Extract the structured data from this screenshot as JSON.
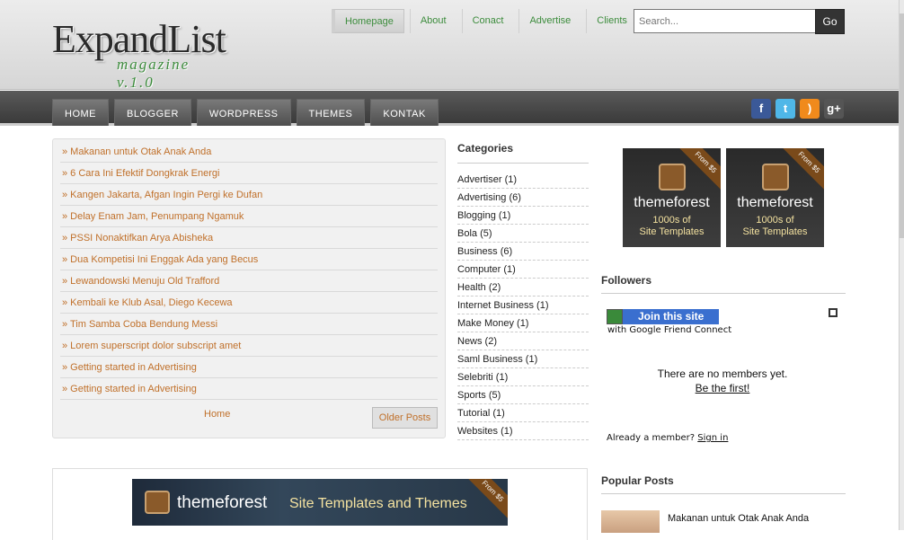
{
  "logo": {
    "title": "ExpandList",
    "subtitle": "magazine v.1.0"
  },
  "top_links": [
    "Homepage",
    "About",
    "Conact",
    "Advertise",
    "Clients"
  ],
  "search": {
    "placeholder": "Search...",
    "button": "Go"
  },
  "nav_menu": [
    "HOME",
    "BLOGGER",
    "WORDPRESS",
    "THEMES",
    "KONTAK"
  ],
  "social_icons": [
    {
      "name": "facebook-icon",
      "glyph": "f",
      "color": "#3b5998"
    },
    {
      "name": "twitter-icon",
      "glyph": "t",
      "color": "#4fb7e8"
    },
    {
      "name": "rss-icon",
      "glyph": ")",
      "color": "#f08a1c"
    },
    {
      "name": "google-plus-icon",
      "glyph": "g+",
      "color": "#555555"
    }
  ],
  "posts": [
    "» Makanan untuk Otak Anak Anda",
    "» 6 Cara Ini Efektif Dongkrak Energi",
    "» Kangen Jakarta, Afgan Ingin Pergi ke Dufan",
    "» Delay Enam Jam, Penumpang Ngamuk",
    "» PSSI Nonaktifkan Arya Abisheka",
    "» Dua Kompetisi Ini Enggak Ada yang Becus",
    "» Lewandowski Menuju Old Trafford",
    "» Kembali ke Klub Asal, Diego Kecewa",
    "» Tim Samba Coba Bendung Messi",
    "» Lorem superscript dolor subscript amet",
    "» Getting started in Advertising",
    "» Getting started in Advertising"
  ],
  "pager": {
    "home": "Home",
    "older": "Older Posts"
  },
  "categories": {
    "title": "Categories",
    "items": [
      "Advertiser (1)",
      "Advertising (6)",
      "Blogging (1)",
      "Bola (5)",
      "Business (6)",
      "Computer (1)",
      "Health (2)",
      "Internet Business (1)",
      "Make Money (1)",
      "News (2)",
      "Saml Business (1)",
      "Selebriti (1)",
      "Sports (5)",
      "Tutorial (1)",
      "Websites (1)"
    ]
  },
  "ads": [
    {
      "brand": "themeforest",
      "line1": "1000s of",
      "line2": "Site Templates",
      "ribbon": "From $5"
    },
    {
      "brand": "themeforest",
      "line1": "1000s of",
      "line2": "Site Templates",
      "ribbon": "From $5"
    }
  ],
  "followers": {
    "title": "Followers",
    "join_label": "Join this site",
    "gfc_label": "with Google Friend Connect",
    "no_members": "There are no members yet.",
    "be_first": "Be the first!",
    "already_label": "Already a member?",
    "sign_in": "Sign in"
  },
  "popular": {
    "title": "Popular Posts",
    "first_post": "Makanan untuk Otak Anak Anda"
  },
  "banner": {
    "brand": "themeforest",
    "tagline": "Site Templates and Themes",
    "ribbon": "From $5"
  }
}
